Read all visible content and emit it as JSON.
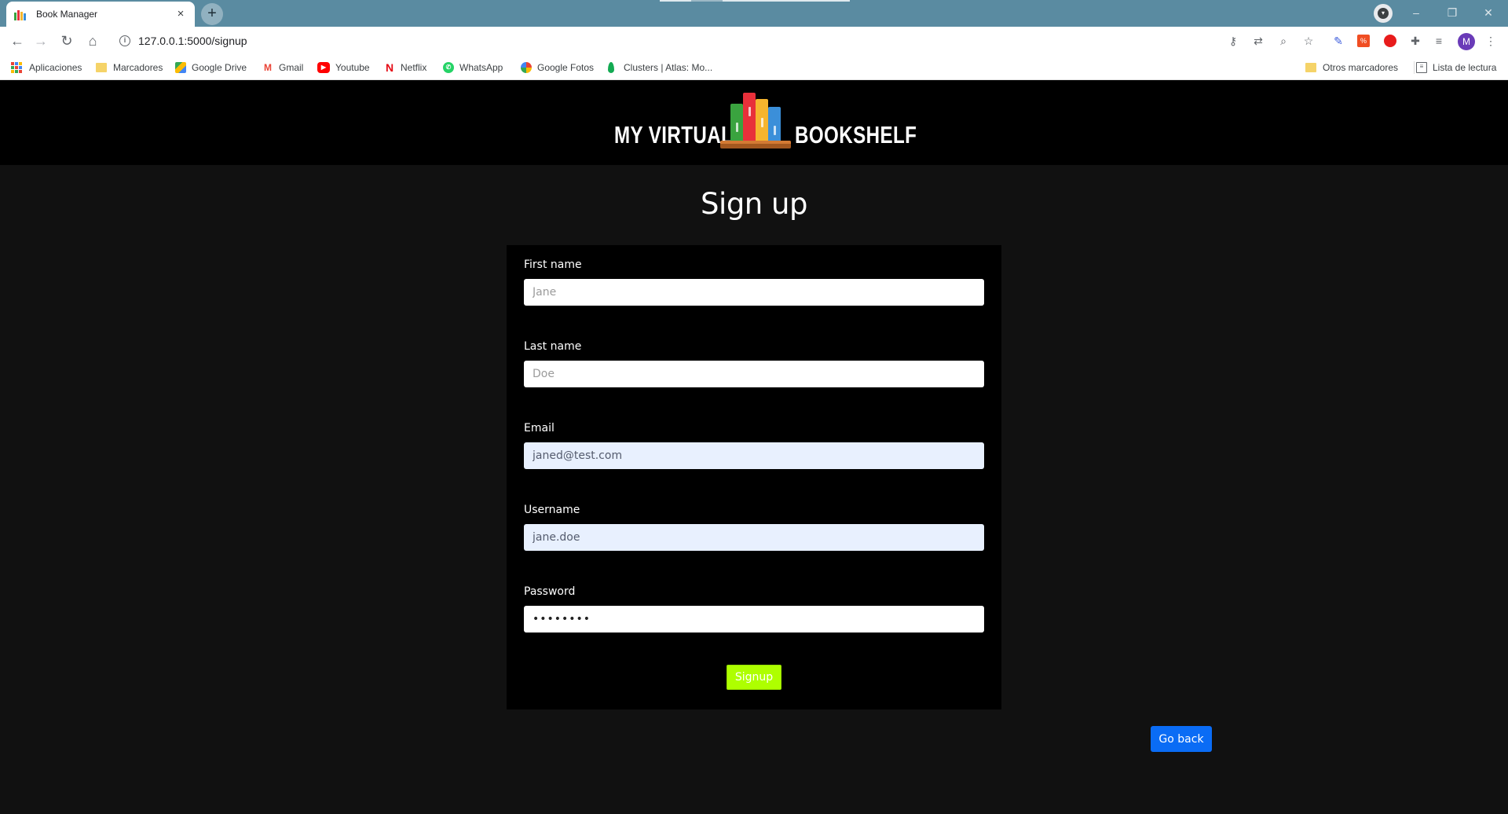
{
  "browser": {
    "tab_title": "Book Manager",
    "tab_close": "×",
    "new_tab": "+",
    "url": "127.0.0.1:5000/signup",
    "avatar_letter": "M",
    "window_controls": [
      "–",
      "❐",
      "✕"
    ]
  },
  "bookmarks": {
    "left": [
      {
        "label": "Aplicaciones",
        "icon": "apps-grid-icon"
      },
      {
        "label": "Marcadores",
        "icon": "folder-icon"
      },
      {
        "label": "Google Drive",
        "icon": "google-drive-icon"
      },
      {
        "label": "Gmail",
        "icon": "gmail-icon"
      },
      {
        "label": "Youtube",
        "icon": "youtube-icon"
      },
      {
        "label": "Netflix",
        "icon": "netflix-icon"
      },
      {
        "label": "WhatsApp",
        "icon": "whatsapp-icon"
      },
      {
        "label": "Google Fotos",
        "icon": "google-photos-icon"
      },
      {
        "label": "Clusters | Atlas: Mo...",
        "icon": "mongodb-leaf-icon"
      }
    ],
    "other_bookmarks": "Otros marcadores",
    "reading_list": "Lista de lectura"
  },
  "header": {
    "logo_left": "MY VIRTUAL",
    "logo_right": "BOOKSHELF",
    "book_colors": [
      "#3aa33f",
      "#e8303a",
      "#f6b52e",
      "#3b8fd9"
    ]
  },
  "page": {
    "title": "Sign up"
  },
  "form": {
    "first_name": {
      "label": "First name",
      "placeholder": "Jane",
      "value": ""
    },
    "last_name": {
      "label": "Last name",
      "placeholder": "Doe",
      "value": ""
    },
    "email": {
      "label": "Email",
      "value": "janed@test.com"
    },
    "username": {
      "label": "Username",
      "value": "jane.doe"
    },
    "password": {
      "label": "Password",
      "value": "••••••••"
    },
    "submit_label": "Signup"
  },
  "actions": {
    "go_back_label": "Go back"
  },
  "colors": {
    "header_bg": "#000000",
    "page_bg": "#111111",
    "signup_button": "#aeff00",
    "go_back_button": "#0a6cf5",
    "tabstrip": "#5a8ba1"
  }
}
